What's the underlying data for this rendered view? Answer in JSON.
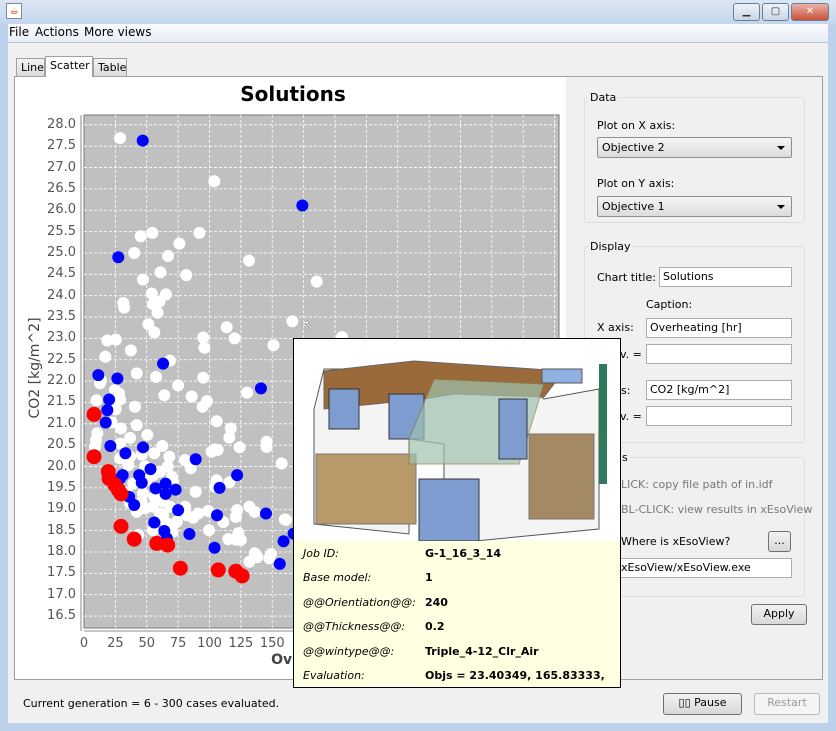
{
  "window": {
    "icon": "java-cup-icon",
    "controls": [
      "minimize",
      "maximize",
      "close"
    ]
  },
  "menu": [
    "File",
    "Actions",
    "More views"
  ],
  "tabs": [
    {
      "label": "Line",
      "selected": false
    },
    {
      "label": "Scatter",
      "selected": true
    },
    {
      "label": "Table",
      "selected": false
    }
  ],
  "chart_data": {
    "type": "scatter",
    "title": "Solutions",
    "xlabel": "Overheating [hr]",
    "ylabel": "CO2 [kg/m^2]",
    "xlim": [
      0,
      378.5
    ],
    "ylim": [
      16.22,
      28.23
    ],
    "x_ticks": [
      "0",
      "25",
      "50",
      "75",
      "100",
      "125",
      "150"
    ],
    "y_ticks": [
      "16.5",
      "17.0",
      "17.5",
      "18.0",
      "18.5",
      "19.0",
      "19.5",
      "20.0",
      "20.5",
      "21.0",
      "21.5",
      "22.0",
      "22.5",
      "23.0",
      "23.5",
      "24.0",
      "24.5",
      "25.0",
      "25.5",
      "26.0",
      "26.5",
      "27.0",
      "27.5",
      "28.0"
    ],
    "grid": true,
    "background": "#c0c0c0",
    "series": [
      {
        "color": "#ffffff",
        "points": [
          [
            28.7,
            27.69
          ],
          [
            103.8,
            26.68
          ],
          [
            45.2,
            25.39
          ],
          [
            54.5,
            25.47
          ],
          [
            92,
            25.47
          ],
          [
            76,
            25.22
          ],
          [
            40,
            25.0
          ],
          [
            67,
            24.93
          ],
          [
            131.5,
            24.82
          ],
          [
            61,
            24.55
          ],
          [
            81.5,
            24.48
          ],
          [
            47,
            24.38
          ],
          [
            185.4,
            24.33
          ],
          [
            54,
            24.05
          ],
          [
            65.3,
            24.03
          ],
          [
            31.3,
            23.83
          ],
          [
            32,
            23.72
          ],
          [
            55,
            23.8
          ],
          [
            60,
            23.86
          ],
          [
            58.6,
            23.6
          ],
          [
            51.3,
            23.33
          ],
          [
            56,
            23.14
          ],
          [
            166,
            23.4
          ],
          [
            113.7,
            23.26
          ],
          [
            120,
            23.0
          ],
          [
            95,
            23.02
          ],
          [
            96,
            22.78
          ],
          [
            151,
            22.84
          ],
          [
            18.6,
            22.95
          ],
          [
            25.3,
            22.97
          ],
          [
            37.3,
            22.72
          ],
          [
            17,
            22.57
          ],
          [
            68.5,
            22.48
          ],
          [
            205.6,
            23.03
          ],
          [
            42,
            22.18
          ],
          [
            57.4,
            22.1
          ],
          [
            95,
            22.08
          ],
          [
            75,
            21.9
          ],
          [
            64,
            21.67
          ],
          [
            85.8,
            21.64
          ],
          [
            130,
            21.73
          ],
          [
            98,
            21.53
          ],
          [
            94.5,
            21.4
          ],
          [
            40.6,
            21.4
          ],
          [
            10,
            21.55
          ],
          [
            12.7,
            21.95
          ],
          [
            13.5,
            22.02
          ],
          [
            24.7,
            21.79
          ],
          [
            27.9,
            21.71
          ],
          [
            28.7,
            21.57
          ],
          [
            25.2,
            21.34
          ],
          [
            22,
            21.03
          ],
          [
            29.5,
            20.89
          ],
          [
            42,
            20.97
          ],
          [
            50.5,
            20.74
          ],
          [
            36.7,
            20.67
          ],
          [
            28.7,
            20.54
          ],
          [
            10.6,
            20.78
          ],
          [
            9.6,
            20.62
          ],
          [
            8.8,
            20.46
          ],
          [
            105.7,
            21.06
          ],
          [
            117,
            20.89
          ],
          [
            115.8,
            20.68
          ],
          [
            124,
            20.45
          ],
          [
            145.5,
            20.58
          ],
          [
            145.5,
            20.46
          ],
          [
            104,
            20.4
          ],
          [
            101.7,
            20.35
          ],
          [
            106.5,
            20.39
          ],
          [
            157.5,
            20.07
          ],
          [
            62.4,
            20.48
          ],
          [
            68,
            20.23
          ],
          [
            80.5,
            20.15
          ],
          [
            85,
            19.96
          ],
          [
            66.7,
            20.0
          ],
          [
            56,
            20.31
          ],
          [
            46,
            20.28
          ],
          [
            36.7,
            20.23
          ],
          [
            28.7,
            20.19
          ],
          [
            35.3,
            20.03
          ],
          [
            48.6,
            20.0
          ],
          [
            55,
            19.8
          ],
          [
            60.6,
            19.88
          ],
          [
            70,
            19.76
          ],
          [
            71,
            19.64
          ],
          [
            39.3,
            19.6
          ],
          [
            49.4,
            19.68
          ],
          [
            56,
            19.29
          ],
          [
            63,
            19.18
          ],
          [
            47,
            19.37
          ],
          [
            46,
            19.18
          ],
          [
            60.6,
            18.9
          ],
          [
            68.5,
            19.06
          ],
          [
            80.5,
            19.06
          ],
          [
            89,
            19.41
          ],
          [
            82,
            18.86
          ],
          [
            87,
            18.8
          ],
          [
            91,
            18.9
          ],
          [
            99,
            18.96
          ],
          [
            105.7,
            19.68
          ],
          [
            104.4,
            19.53
          ],
          [
            115.8,
            19.63
          ],
          [
            111,
            18.7
          ],
          [
            122,
            18.98
          ],
          [
            121,
            18.82
          ],
          [
            131.8,
            19.06
          ],
          [
            136,
            18.94
          ],
          [
            115,
            18.3
          ],
          [
            121,
            18.29
          ],
          [
            123,
            18.44
          ],
          [
            99.6,
            18.51
          ],
          [
            70.6,
            18.47
          ],
          [
            55,
            18.51
          ],
          [
            66,
            18.67
          ],
          [
            74,
            18.71
          ],
          [
            63,
            18.86
          ],
          [
            42,
            18.94
          ],
          [
            48.6,
            19.02
          ],
          [
            55,
            19.06
          ],
          [
            36.7,
            19.14
          ],
          [
            34,
            19.39
          ],
          [
            43.3,
            18.4
          ],
          [
            136,
            17.97
          ],
          [
            131.8,
            17.77
          ],
          [
            147.7,
            17.85
          ],
          [
            160,
            18.76
          ],
          [
            138,
            17.88
          ],
          [
            149,
            17.95
          ],
          [
            161,
            18.75
          ],
          [
            125,
            18.28
          ]
        ]
      },
      {
        "color": "#0000ff",
        "points": [
          [
            46.8,
            27.63
          ],
          [
            174,
            26.11
          ],
          [
            27.3,
            24.9
          ],
          [
            63,
            22.41
          ],
          [
            11.4,
            22.14
          ],
          [
            26.6,
            22.06
          ],
          [
            20,
            21.57
          ],
          [
            18.6,
            21.32
          ],
          [
            17.3,
            21.03
          ],
          [
            21,
            20.48
          ],
          [
            33,
            20.31
          ],
          [
            47,
            20.45
          ],
          [
            53,
            19.94
          ],
          [
            44,
            19.8
          ],
          [
            46,
            19.62
          ],
          [
            30.8,
            19.8
          ],
          [
            28.7,
            19.72
          ],
          [
            57,
            19.49
          ],
          [
            65,
            19.6
          ],
          [
            65,
            19.36
          ],
          [
            73,
            19.46
          ],
          [
            36,
            19.29
          ],
          [
            40,
            19.1
          ],
          [
            75,
            18.98
          ],
          [
            89,
            20.17
          ],
          [
            122,
            19.8
          ],
          [
            108,
            19.5
          ],
          [
            106,
            18.86
          ],
          [
            145,
            18.9
          ],
          [
            56,
            18.69
          ],
          [
            64,
            18.49
          ],
          [
            66,
            18.32
          ],
          [
            84,
            18.42
          ],
          [
            104,
            18.1
          ],
          [
            159,
            18.25
          ],
          [
            167,
            18.43
          ],
          [
            156,
            17.72
          ],
          [
            141,
            21.83
          ]
        ]
      },
      {
        "color": "#ff0000",
        "points": [
          [
            8,
            21.22
          ],
          [
            8,
            20.23
          ],
          [
            19.4,
            19.88
          ],
          [
            20,
            19.72
          ],
          [
            24.7,
            19.57
          ],
          [
            27.4,
            19.45
          ],
          [
            29.5,
            19.36
          ],
          [
            29.5,
            18.6
          ],
          [
            40,
            18.3
          ],
          [
            58,
            18.2
          ],
          [
            66.7,
            18.16
          ],
          [
            76.8,
            17.62
          ],
          [
            107,
            17.58
          ],
          [
            121,
            17.55
          ],
          [
            126,
            17.44
          ]
        ]
      }
    ]
  },
  "panel": {
    "data_group": "Data",
    "plot_x_label": "Plot on X axis:",
    "plot_x_value": "Objective 2",
    "plot_y_label": "Plot on Y axis:",
    "plot_y_value": "Objective 1",
    "display_group": "Display",
    "chart_title_label": "Chart title:",
    "chart_title_value": "Solutions",
    "caption_label": "Caption:",
    "x_axis_label": "X axis:",
    "x_axis_value": "Overheating [hr]",
    "x_div_label": "v. =",
    "x_div_value": "",
    "y_axis_label": "s:",
    "y_axis_value": "CO2 [kg/m^2]",
    "y_div_label": "v. =",
    "y_div_value": "",
    "tips_group": "s",
    "tip1": "LICK: copy file path of in.idf",
    "tip2": "BL-CLICK: view results in xEsoView",
    "where_label": "Where is xEsoView?",
    "browse_button": "...",
    "path_value": "xEsoView/xEsoView.exe",
    "apply_button": "Apply"
  },
  "status": "Current generation = 6 - 300 cases evaluated.",
  "pause_button": "Pause",
  "restart_button": "Restart",
  "tooltip": {
    "rows": [
      {
        "label": "Job ID:",
        "value": "G-1_16_3_14"
      },
      {
        "label": "Base model:",
        "value": "1"
      },
      {
        "label": "@@Orientiation@@:",
        "value": "240"
      },
      {
        "label": "@@Thickness@@:",
        "value": "0.2"
      },
      {
        "label": "@@wintype@@:",
        "value": "Triple_4-12_Clr_Air"
      },
      {
        "label": "Evaluation:",
        "value": "Objs = 23.40349, 165.83333,"
      }
    ]
  }
}
